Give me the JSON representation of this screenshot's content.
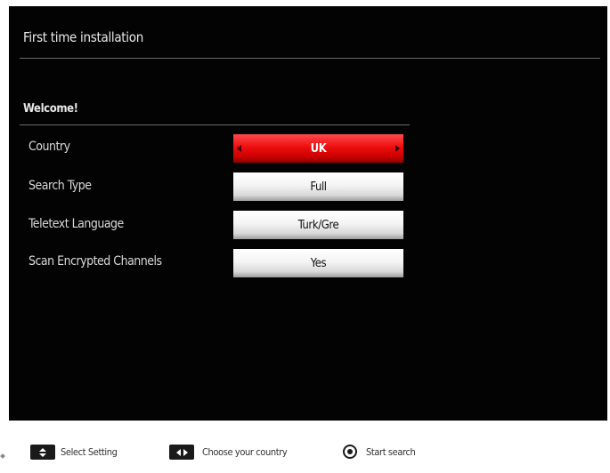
{
  "header": {
    "title": "First time installation"
  },
  "section": {
    "title": "Welcome!"
  },
  "settings": [
    {
      "label": "Country",
      "value": "UK",
      "selected": true
    },
    {
      "label": "Search Type",
      "value": "Full",
      "selected": false
    },
    {
      "label": "Teletext Language",
      "value": "Turk/Gre",
      "selected": false
    },
    {
      "label": "Scan Encrypted Channels",
      "value": "Yes",
      "selected": false
    }
  ],
  "footer": {
    "hints": [
      {
        "icon": "up-down-key-icon",
        "label": "Select Setting"
      },
      {
        "icon": "left-right-key-icon",
        "label": "Choose your country"
      },
      {
        "icon": "ok-key-icon",
        "label": "Start search"
      }
    ]
  },
  "colors": {
    "background": "#030303",
    "selected": "#e60000",
    "normal": "#f4f4f4"
  }
}
